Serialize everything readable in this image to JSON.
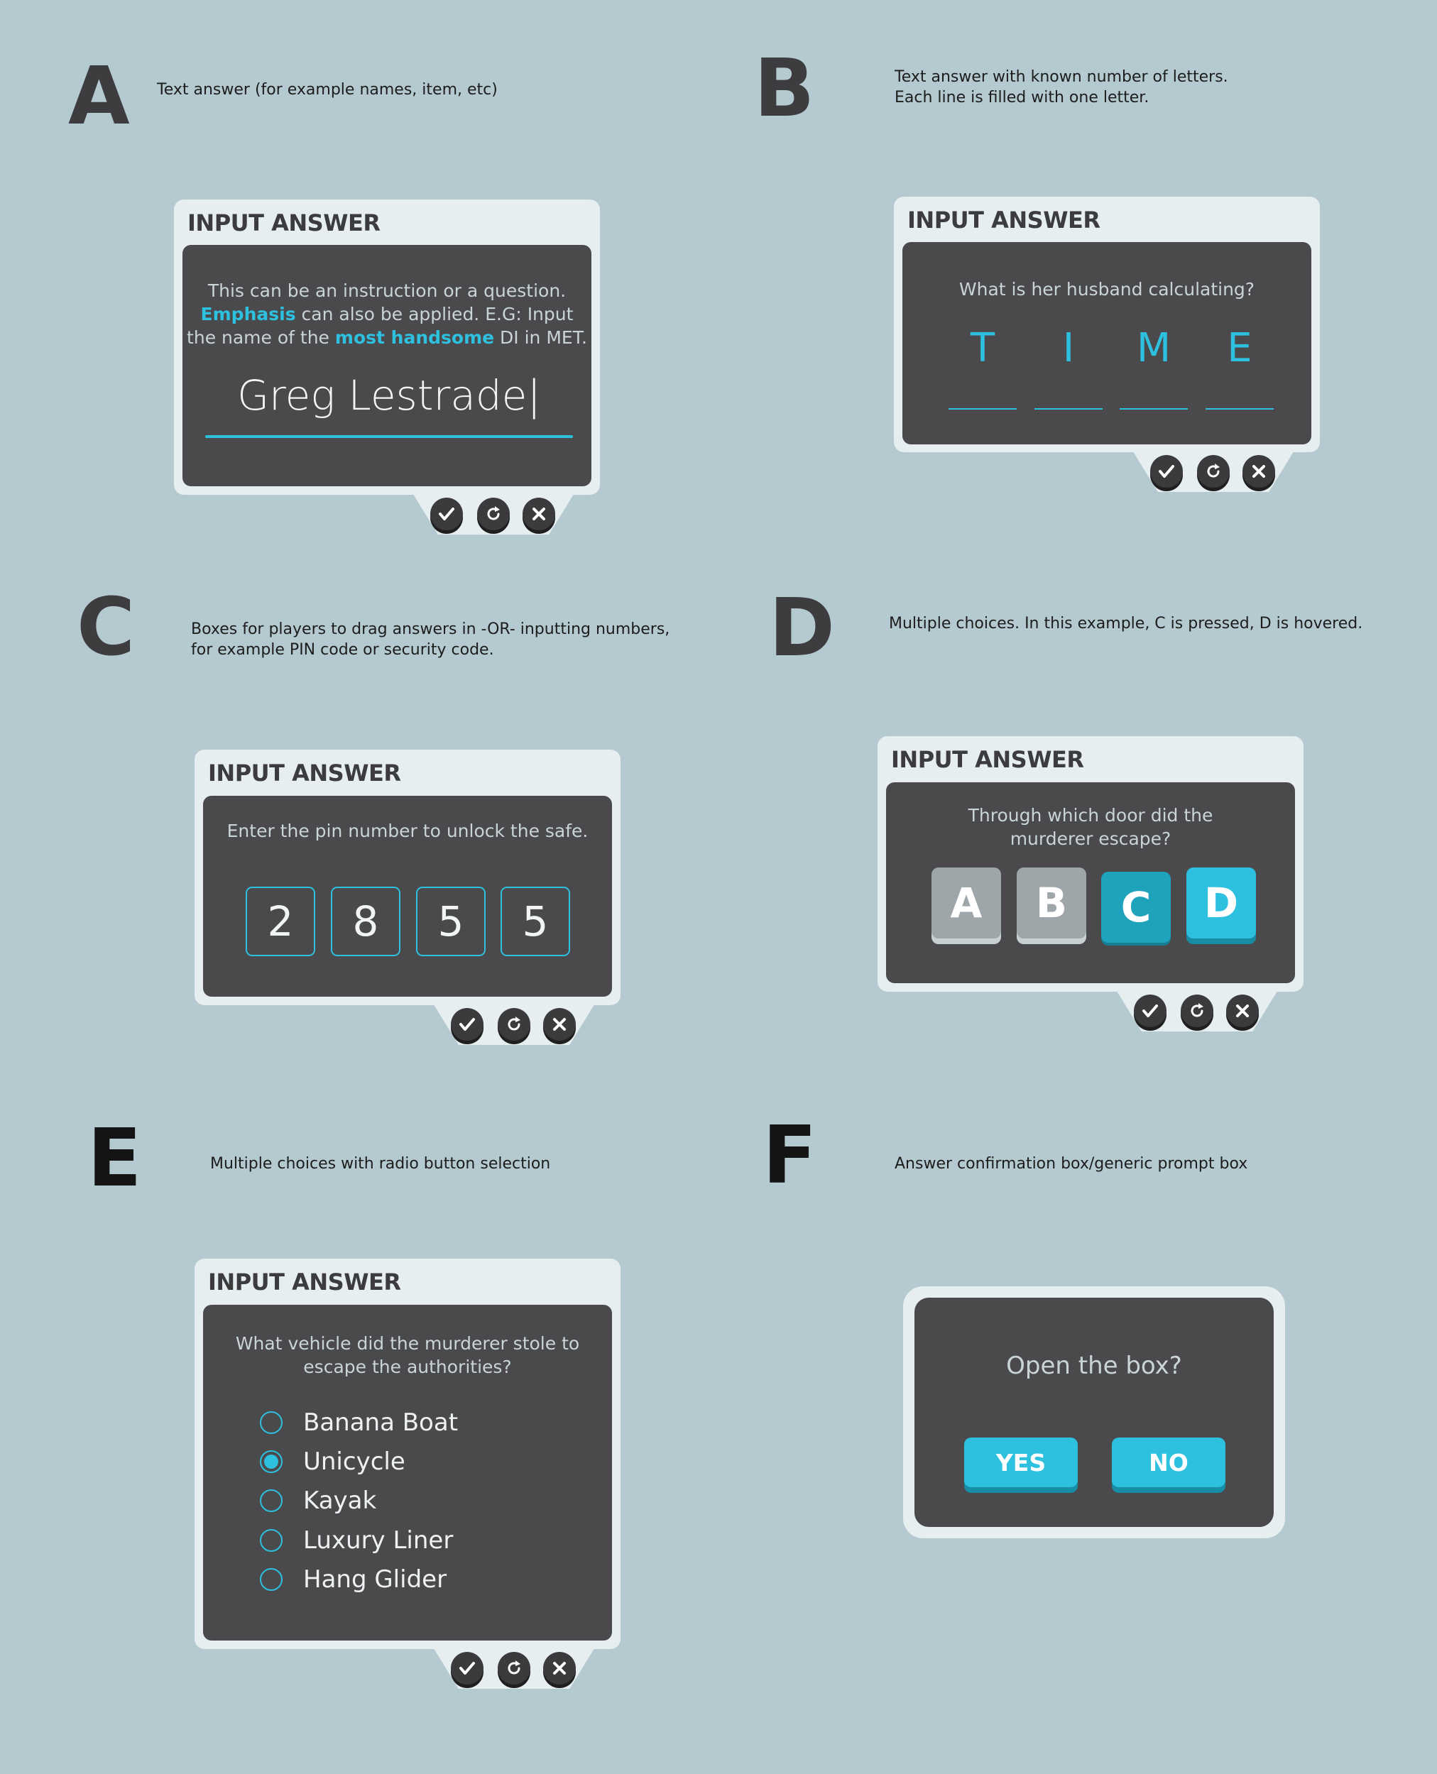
{
  "sections": [
    {
      "letter": "A",
      "description": "Text answer (for example names, item, etc)"
    },
    {
      "letter": "B",
      "description": "Text answer with known number of letters.\nEach line is filled with one letter."
    },
    {
      "letter": "C",
      "description": "Boxes for players to drag answers in -OR- inputting numbers,\nfor example PIN code or security code."
    },
    {
      "letter": "D",
      "description": "Multiple choices. In this example, C is pressed, D is hovered."
    },
    {
      "letter": "E",
      "description": "Multiple choices with radio button selection"
    },
    {
      "letter": "F",
      "description": "Answer confirmation box/generic prompt box"
    }
  ],
  "panel_title": "INPUT ANSWER",
  "panel_a": {
    "prompt_line1": "This can be an instruction or a question.",
    "prompt_em1": "Emphasis",
    "prompt_line2_rest": " can also be applied. E.G: Input",
    "prompt_line3_pre": "the name of the ",
    "prompt_em2": "most handsome",
    "prompt_line3_post": " DI in MET.",
    "input_value": "Greg Lestrade|"
  },
  "panel_b": {
    "prompt": "What is her husband calculating?",
    "letters": [
      "T",
      "I",
      "M",
      "E"
    ]
  },
  "panel_c": {
    "prompt": "Enter the pin number to unlock the safe.",
    "digits": [
      "2",
      "8",
      "5",
      "5"
    ]
  },
  "panel_d": {
    "prompt_line1": "Through which door did the",
    "prompt_line2": "murderer escape?",
    "choices": [
      {
        "label": "A",
        "state": "normal"
      },
      {
        "label": "B",
        "state": "normal"
      },
      {
        "label": "C",
        "state": "pressed"
      },
      {
        "label": "D",
        "state": "hovered"
      }
    ]
  },
  "panel_e": {
    "prompt_line1": "What vehicle did the murderer stole to",
    "prompt_line2": "escape the authorities?",
    "options": [
      {
        "label": "Banana Boat",
        "selected": false
      },
      {
        "label": "Unicycle",
        "selected": true
      },
      {
        "label": "Kayak",
        "selected": false
      },
      {
        "label": "Luxury Liner",
        "selected": false
      },
      {
        "label": "Hang Glider",
        "selected": false
      }
    ]
  },
  "panel_f": {
    "prompt": "Open the box?",
    "yes_label": "YES",
    "no_label": "NO"
  },
  "controls": {
    "confirm_icon": "check-icon",
    "reset_icon": "refresh-icon",
    "close_icon": "close-icon"
  },
  "colors": {
    "background": "#b4c9d0",
    "panel_frame": "#e7eef0",
    "screen": "#4a494b",
    "accent": "#2ec0df",
    "choice_normal": "#9ea6aa",
    "choice_pressed": "#1fa3bd",
    "title_dark": "#3c3c3e"
  }
}
